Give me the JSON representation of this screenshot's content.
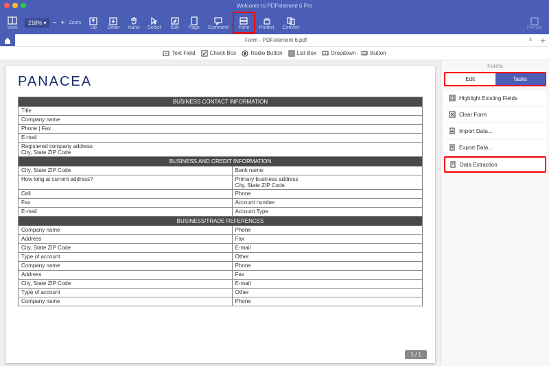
{
  "app_title": "Welcome to PDFelement 6 Pro",
  "toolbar": {
    "view": "View",
    "zoom": "Zoom",
    "zoom_value": "218%",
    "up": "Up",
    "down": "Down",
    "hand": "Hand",
    "select": "Select",
    "edit": "Edit",
    "page": "Page",
    "comment": "Comment",
    "form": "Form",
    "protect": "Protect",
    "convert": "Convert",
    "format": "Format"
  },
  "tab_title": "Form - PDFelement 6.pdf",
  "form_toolbar": {
    "text_field": "Text Field",
    "check_box": "Check Box",
    "radio_button": "Radio Button",
    "list_box": "List Box",
    "dropdown": "Dropdown",
    "button": "Button"
  },
  "document": {
    "logo": "PANACEA",
    "sections": {
      "s1": "BUSINESS CONTACT INFORMATION",
      "s2": "BUSINESS AND CREDIT INFORMATION",
      "s3": "BUSINESS/TRADE REFERENCES"
    },
    "r": {
      "title": "Title",
      "company": "Company name",
      "phone_fax": "Phone | Fax",
      "email": "E-mail",
      "reg_addr": "Registered company address\nCity, State ZIP Code",
      "city_zip": "City, State ZIP Code",
      "bank": "Bank name:",
      "howlong": "How long at current address?",
      "prim_addr": "Primary business address\nCity, State ZIP Code",
      "cell": "Cell",
      "phone": "Phone",
      "fax": "Fax",
      "acct_num": "Account number",
      "acct_type": "Account Type",
      "addr": "Address",
      "type_acct": "Type of account",
      "other": "Other"
    }
  },
  "page_num": "1 / 1",
  "side": {
    "title": "Forms",
    "edit": "Edit",
    "tasks": "Tasks",
    "items": {
      "highlight": "Highlight Existing Fields",
      "clear": "Clear Form",
      "import": "Import Data...",
      "export": "Export Data...",
      "extract": "Data Extraction"
    }
  }
}
